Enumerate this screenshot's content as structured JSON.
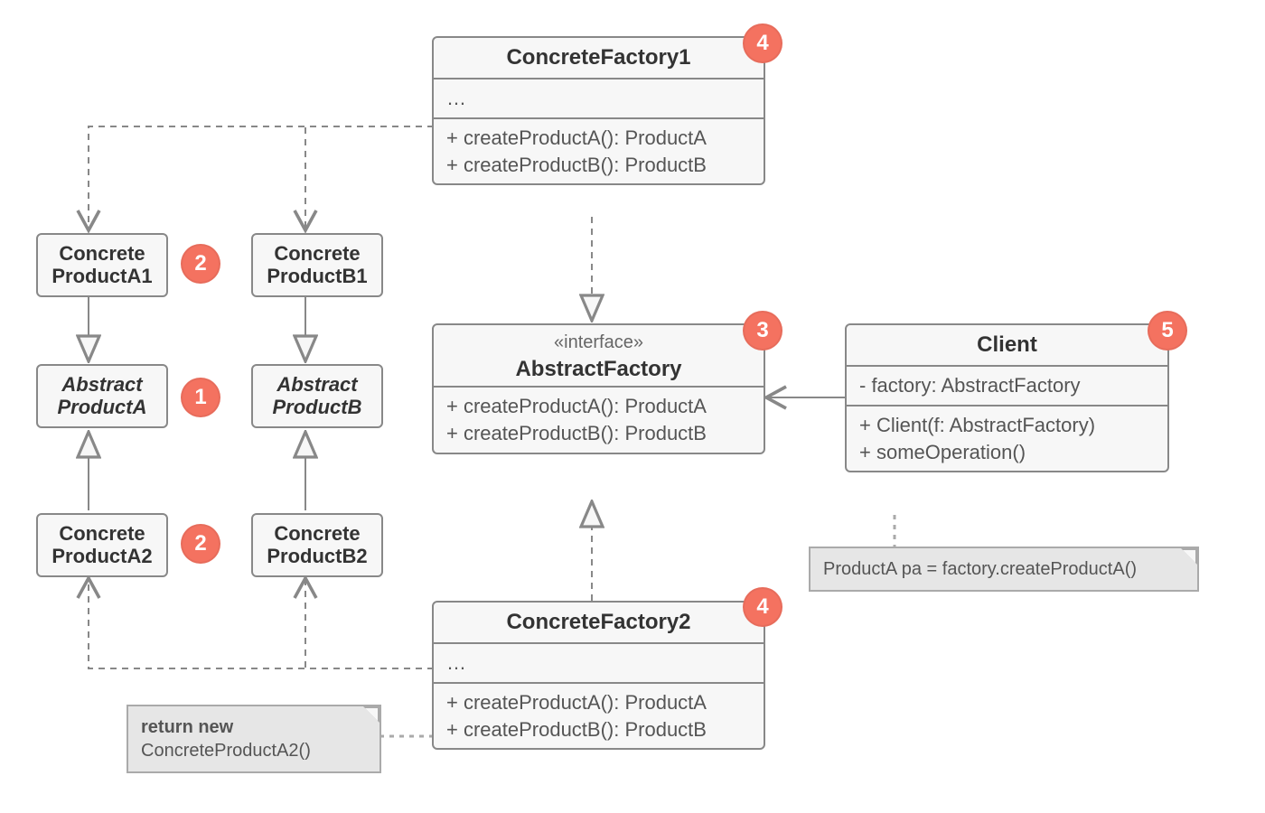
{
  "boxes": {
    "concreteFactory1": {
      "title": "ConcreteFactory1",
      "attrs": "…",
      "ops1": "+ createProductA(): ProductA",
      "ops2": "+ createProductB(): ProductB"
    },
    "abstractFactory": {
      "stereo": "«interface»",
      "title": "AbstractFactory",
      "ops1": "+ createProductA(): ProductA",
      "ops2": "+ createProductB(): ProductB"
    },
    "concreteFactory2": {
      "title": "ConcreteFactory2",
      "attrs": "…",
      "ops1": "+ createProductA(): ProductA",
      "ops2": "+ createProductB(): ProductB"
    },
    "client": {
      "title": "Client",
      "attrs": "- factory: AbstractFactory",
      "ops1": "+ Client(f: AbstractFactory)",
      "ops2": "+ someOperation()"
    }
  },
  "mini": {
    "concreteProductA1a": "Concrete",
    "concreteProductA1b": "ProductA1",
    "concreteProductB1a": "Concrete",
    "concreteProductB1b": "ProductB1",
    "abstractProductAa": "Abstract",
    "abstractProductAb": "ProductA",
    "abstractProductBa": "Abstract",
    "abstractProductBb": "ProductB",
    "concreteProductA2a": "Concrete",
    "concreteProductA2b": "ProductA2",
    "concreteProductB2a": "Concrete",
    "concreteProductB2b": "ProductB2"
  },
  "notes": {
    "factory2note_l1": "return new",
    "factory2note_l2": "ConcreteProductA2()",
    "clientNote": "ProductA pa = factory.createProductA()"
  },
  "badges": {
    "b1": "1",
    "b2a": "2",
    "b2b": "2",
    "b3": "3",
    "b4a": "4",
    "b4b": "4",
    "b5": "5"
  },
  "chart_data": {
    "type": "uml-class-diagram",
    "pattern": "Abstract Factory",
    "classes": [
      {
        "name": "AbstractFactory",
        "stereotype": "interface",
        "operations": [
          "+ createProductA(): ProductA",
          "+ createProductB(): ProductB"
        ]
      },
      {
        "name": "ConcreteFactory1",
        "attributes": [
          "…"
        ],
        "operations": [
          "+ createProductA(): ProductA",
          "+ createProductB(): ProductB"
        ]
      },
      {
        "name": "ConcreteFactory2",
        "attributes": [
          "…"
        ],
        "operations": [
          "+ createProductA(): ProductA",
          "+ createProductB(): ProductB"
        ]
      },
      {
        "name": "Client",
        "attributes": [
          "- factory: AbstractFactory"
        ],
        "operations": [
          "+ Client(f: AbstractFactory)",
          "+ someOperation()"
        ]
      },
      {
        "name": "AbstractProductA",
        "abstract": true
      },
      {
        "name": "AbstractProductB",
        "abstract": true
      },
      {
        "name": "ConcreteProductA1"
      },
      {
        "name": "ConcreteProductA2"
      },
      {
        "name": "ConcreteProductB1"
      },
      {
        "name": "ConcreteProductB2"
      }
    ],
    "relations": [
      {
        "from": "ConcreteFactory1",
        "to": "AbstractFactory",
        "type": "realization"
      },
      {
        "from": "ConcreteFactory2",
        "to": "AbstractFactory",
        "type": "realization"
      },
      {
        "from": "ConcreteProductA1",
        "to": "AbstractProductA",
        "type": "realization"
      },
      {
        "from": "ConcreteProductA2",
        "to": "AbstractProductA",
        "type": "realization"
      },
      {
        "from": "ConcreteProductB1",
        "to": "AbstractProductB",
        "type": "realization"
      },
      {
        "from": "ConcreteProductB2",
        "to": "AbstractProductB",
        "type": "realization"
      },
      {
        "from": "ConcreteFactory1",
        "to": "ConcreteProductA1",
        "type": "dependency-create"
      },
      {
        "from": "ConcreteFactory1",
        "to": "ConcreteProductB1",
        "type": "dependency-create"
      },
      {
        "from": "ConcreteFactory2",
        "to": "ConcreteProductA2",
        "type": "dependency-create"
      },
      {
        "from": "ConcreteFactory2",
        "to": "ConcreteProductB2",
        "type": "dependency-create"
      },
      {
        "from": "Client",
        "to": "AbstractFactory",
        "type": "association"
      }
    ],
    "notes": [
      {
        "attachedTo": "ConcreteFactory2",
        "text": "return new ConcreteProductA2()"
      },
      {
        "attachedTo": "Client",
        "text": "ProductA pa = factory.createProductA()"
      }
    ],
    "annotations": [
      {
        "n": 1,
        "targets": [
          "AbstractProductA",
          "AbstractProductB"
        ]
      },
      {
        "n": 2,
        "targets": [
          "ConcreteProductA1",
          "ConcreteProductB1",
          "ConcreteProductA2",
          "ConcreteProductB2"
        ]
      },
      {
        "n": 3,
        "targets": [
          "AbstractFactory"
        ]
      },
      {
        "n": 4,
        "targets": [
          "ConcreteFactory1",
          "ConcreteFactory2"
        ]
      },
      {
        "n": 5,
        "targets": [
          "Client"
        ]
      }
    ]
  }
}
